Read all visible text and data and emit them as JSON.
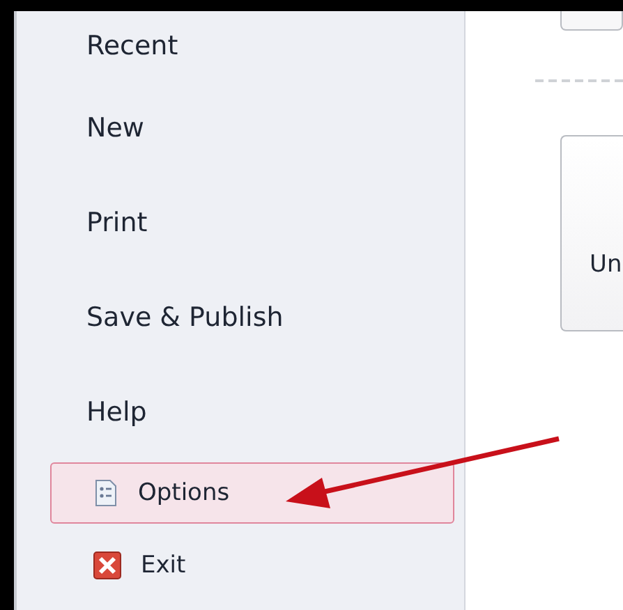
{
  "menu": {
    "items": [
      {
        "label": "Recent",
        "kind": "tab",
        "selected": false
      },
      {
        "label": "New",
        "kind": "tab",
        "selected": false
      },
      {
        "label": "Print",
        "kind": "tab",
        "selected": false
      },
      {
        "label": "Save & Publish",
        "kind": "tab",
        "selected": false
      },
      {
        "label": "Help",
        "kind": "tab",
        "selected": false
      },
      {
        "label": "Options",
        "kind": "options",
        "selected": true
      },
      {
        "label": "Exit",
        "kind": "exit",
        "selected": false
      }
    ]
  },
  "content": {
    "card": {
      "label": "Un"
    }
  }
}
